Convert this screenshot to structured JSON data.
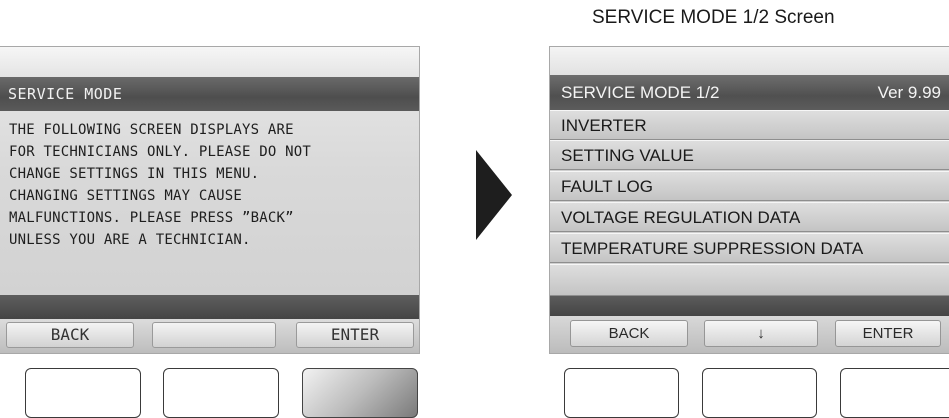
{
  "caption": "SERVICE MODE 1/2 Screen",
  "left_screen": {
    "title": "SERVICE MODE",
    "message_lines": [
      "THE FOLLOWING SCREEN DISPLAYS ARE",
      "FOR TECHNICIANS ONLY. PLEASE DO NOT",
      "CHANGE SETTINGS IN THIS MENU.",
      "CHANGING SETTINGS MAY CAUSE",
      "MALFUNCTIONS. PLEASE PRESS ”BACK”",
      "UNLESS YOU ARE A TECHNICIAN."
    ],
    "softkeys": {
      "back": "BACK",
      "middle": "",
      "enter": "ENTER"
    }
  },
  "right_screen": {
    "title": "SERVICE MODE 1/2",
    "version": "Ver 9.99",
    "menu_items": [
      "INVERTER",
      "SETTING VALUE",
      "FAULT LOG",
      "VOLTAGE REGULATION DATA",
      "TEMPERATURE SUPPRESSION DATA"
    ],
    "softkeys": {
      "back": "BACK",
      "down": "↓",
      "enter": "ENTER"
    }
  },
  "icons": {
    "transition_arrow": "play-arrow-icon"
  },
  "colors": {
    "title_bar": "#555555",
    "screen_bg": "#cfcfcf",
    "text": "#1a1a1a"
  }
}
